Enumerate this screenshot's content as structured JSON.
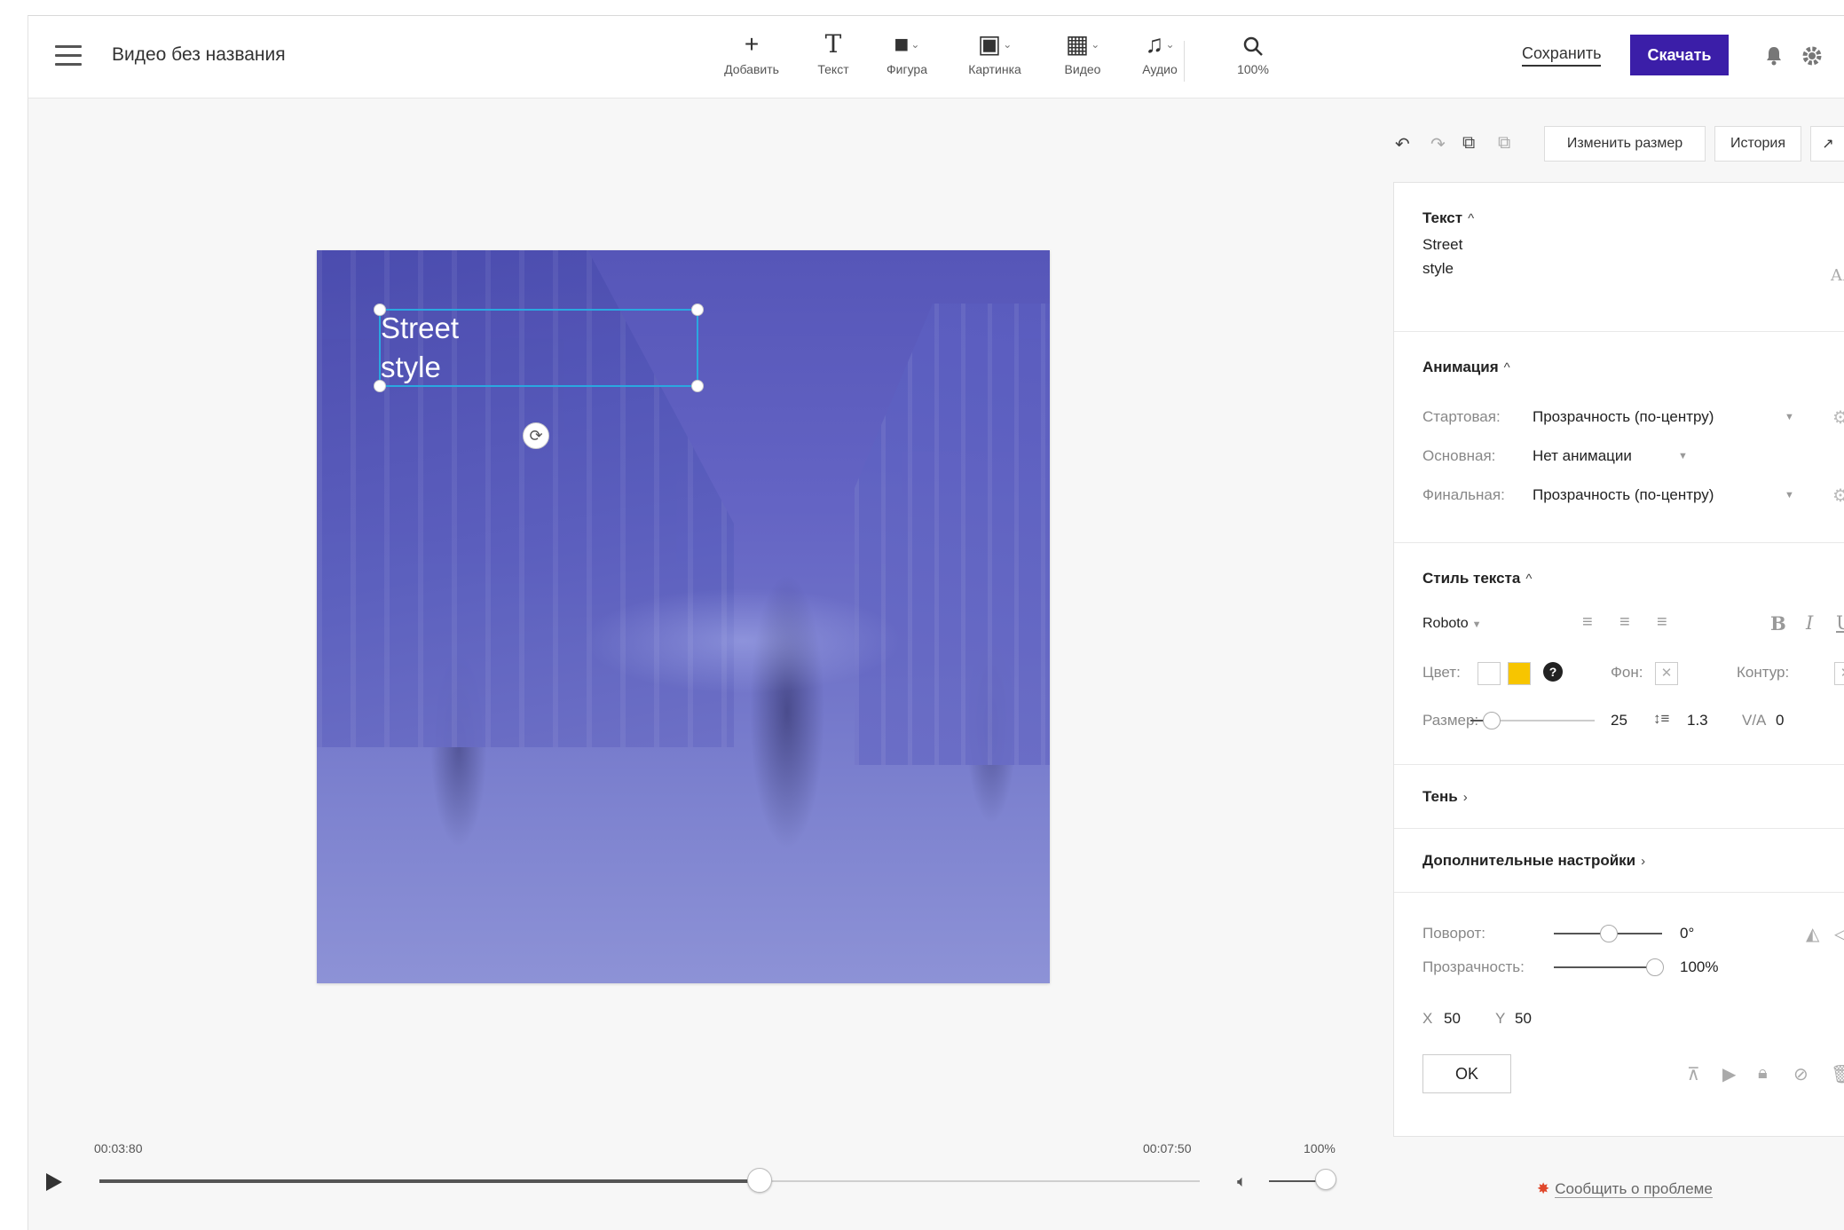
{
  "header": {
    "title": "Видео без названия",
    "tools": [
      {
        "icon": "plus-icon",
        "glyph": "+",
        "label": "Добавить"
      },
      {
        "icon": "text-icon",
        "glyph": "T",
        "label": "Текст"
      },
      {
        "icon": "shape-icon",
        "glyph": "■",
        "label": "Фигура"
      },
      {
        "icon": "image-icon",
        "glyph": "▣",
        "label": "Картинка"
      },
      {
        "icon": "video-icon",
        "glyph": "▦",
        "label": "Видео"
      },
      {
        "icon": "music-icon",
        "glyph": "♫",
        "label": "Аудио"
      },
      {
        "icon": "search-icon",
        "glyph": "⌕",
        "label": "100%"
      }
    ],
    "save_label": "Сохранить",
    "download_label": "Скачать"
  },
  "canvas": {
    "text_line1": "Street",
    "text_line2": "style"
  },
  "timeline": {
    "time_start": "00:03:80",
    "time_end": "00:07:50",
    "volume_pct": "100%",
    "progress": 0.6,
    "volume": 1.0
  },
  "right_panel": {
    "resize_label": "Изменить размер",
    "history_label": "История",
    "text_section": {
      "title": "Текст",
      "line1": "Street",
      "line2": "style",
      "case_glyph": "AA"
    },
    "animation": {
      "title": "Анимация",
      "start_label": "Стартовая:",
      "start_value": "Прозрачность (по-центру)",
      "main_label": "Основная:",
      "main_value": "Нет анимации",
      "final_label": "Финальная:",
      "final_value": "Прозрачность (по-центру)"
    },
    "text_style": {
      "title": "Стиль текста",
      "font": "Roboto",
      "color_label": "Цвет:",
      "color_swatch_1": "#ffffff",
      "color_swatch_2": "#f7c500",
      "bg_label": "Фон:",
      "outline_label": "Контур:",
      "size_label": "Размер:",
      "size_value": "25",
      "line_height": "1.3",
      "letter_spacing_label": "V/A",
      "letter_spacing": "0",
      "bold": "B",
      "italic": "I",
      "underline": "U"
    },
    "shadow_title": "Тень",
    "advanced_title": "Дополнительные настройки",
    "transform": {
      "rotation_label": "Поворот:",
      "rotation_value": "0°",
      "opacity_label": "Прозрачность:",
      "opacity_value": "100%",
      "x_label": "X",
      "x_value": "50",
      "y_label": "Y",
      "y_value": "50",
      "ok_label": "OK"
    },
    "report_label": "Сообщить о проблеме"
  },
  "colors": {
    "accent": "#3b1ea8",
    "selection": "#2aa8e0"
  }
}
